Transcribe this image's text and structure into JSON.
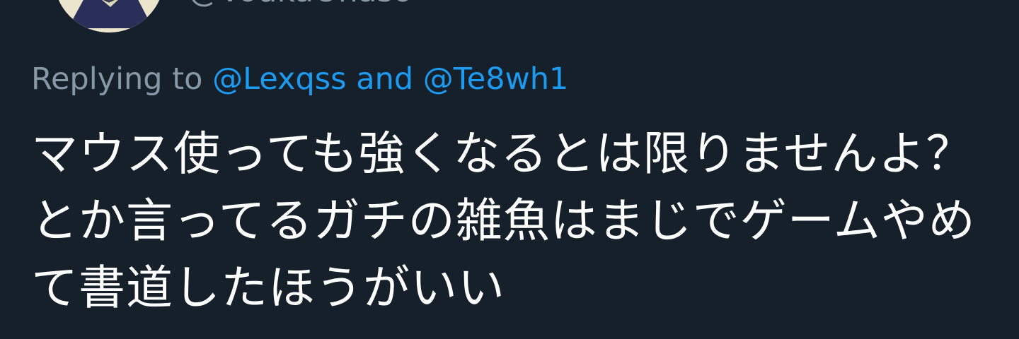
{
  "author": {
    "handle": "@VodkaOhaso",
    "avatar_icon": "user-avatar"
  },
  "reply": {
    "prefix": "Replying to",
    "mention1": "@Lexqss",
    "conjunction": "and",
    "mention2": "@Te8wh1"
  },
  "tweet": {
    "text": "マウス使っても強くなるとは限りませんよ？とか言ってるガチの雑魚はまじでゲームやめて書道したほうがいい"
  },
  "colors": {
    "background": "#15202b",
    "secondary_text": "#8899a6",
    "link": "#1d9bf0",
    "primary_text": "#ffffff"
  }
}
